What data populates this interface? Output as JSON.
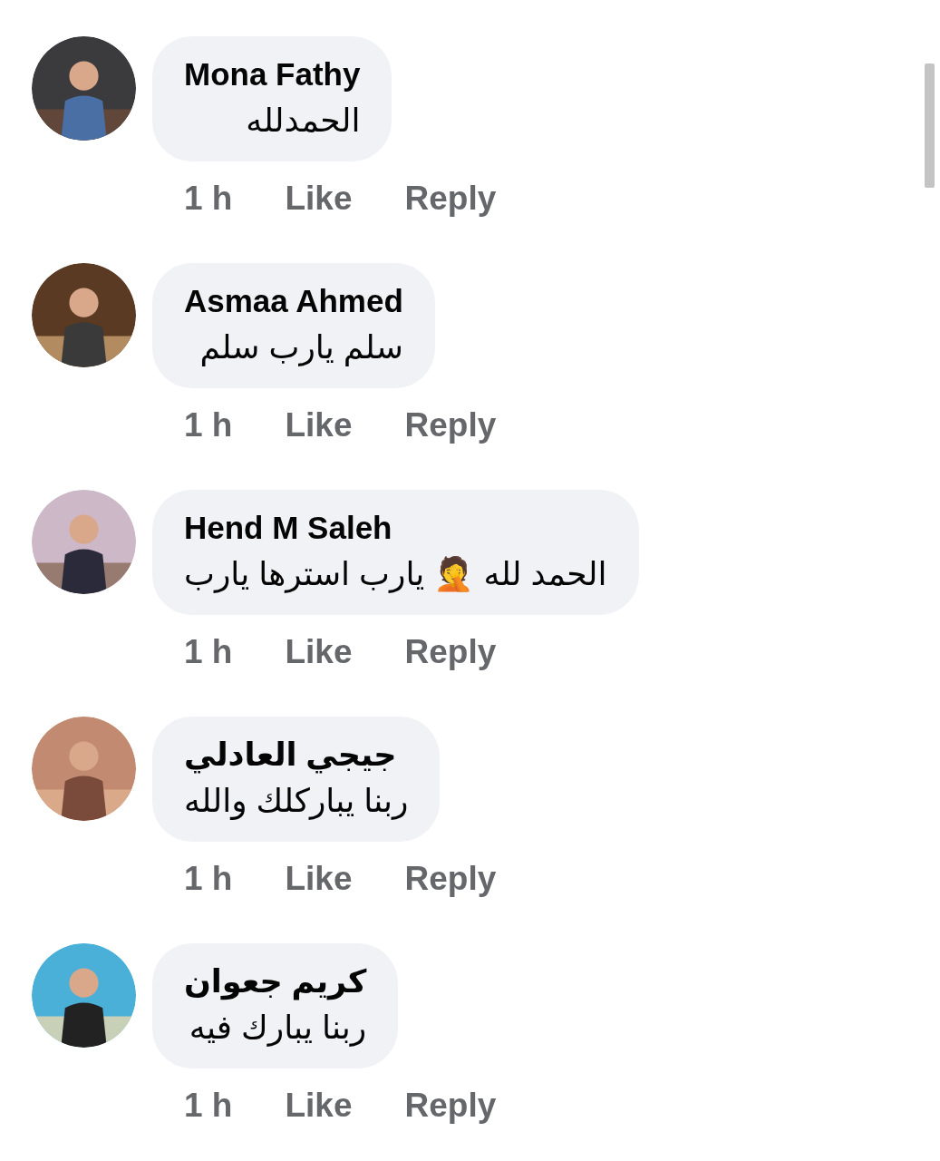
{
  "comments": [
    {
      "author": "Mona Fathy",
      "text": "الحمدلله",
      "time": "1 h",
      "like": "Like",
      "reply": "Reply"
    },
    {
      "author": "Asmaa Ahmed",
      "text": "سلم يارب سلم",
      "time": "1 h",
      "like": "Like",
      "reply": "Reply"
    },
    {
      "author": "Hend M Saleh",
      "text": "الحمد لله 🤦 يارب استرها يارب",
      "time": "1 h",
      "like": "Like",
      "reply": "Reply"
    },
    {
      "author": "جيجي العادلي",
      "text": "ربنا يباركلك والله",
      "time": "1 h",
      "like": "Like",
      "reply": "Reply"
    },
    {
      "author": "كريم جعوان",
      "text": "ربنا يبارك فيه",
      "time": "1 h",
      "like": "Like",
      "reply": "Reply"
    }
  ]
}
